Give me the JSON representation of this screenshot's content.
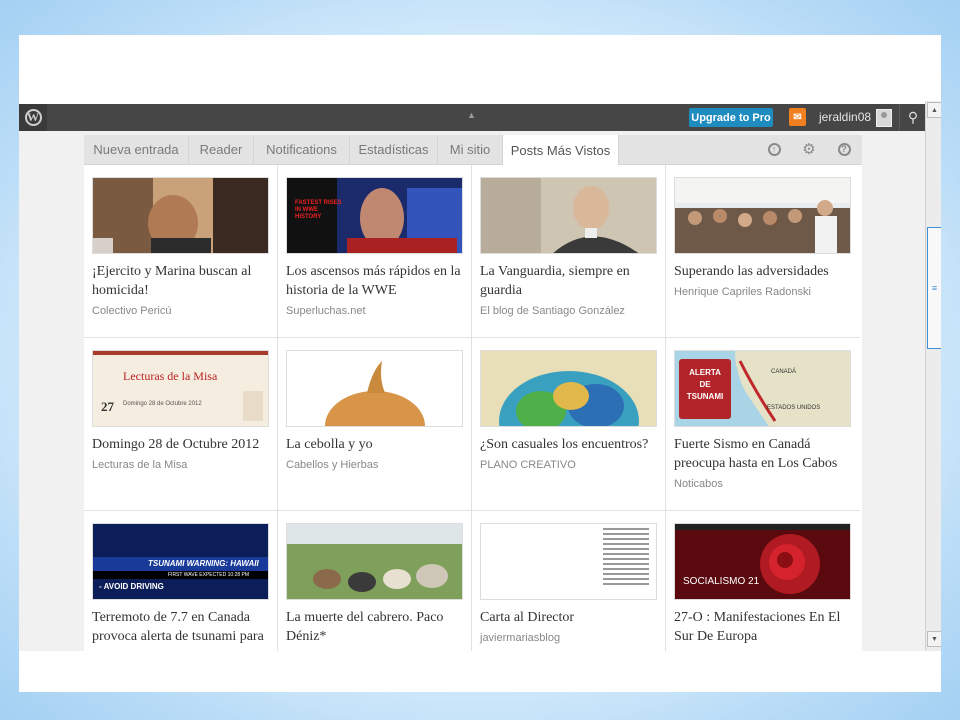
{
  "toolbar": {
    "logo_icon": "wordpress-logo-icon",
    "upgrade_label": "Upgrade to Pro",
    "username": "jeraldin08",
    "notification_icon": "notification-bell-icon",
    "search_icon": "search-icon"
  },
  "tabs": [
    {
      "label": "Nueva entrada"
    },
    {
      "label": "Reader"
    },
    {
      "label": "Notifications"
    },
    {
      "label": "Estadísticas"
    },
    {
      "label": "Mi sitio"
    },
    {
      "label": "Posts Más Vistos"
    }
  ],
  "tab_icons": [
    "upload-icon",
    "gear-icon",
    "help-icon"
  ],
  "posts": [
    {
      "title": "¡Ejercito y Marina buscan al homicida!",
      "source": "Colectivo Pericú"
    },
    {
      "title": "Los ascensos más rápidos en la historia de la WWE",
      "source": "Superluchas.net"
    },
    {
      "title": "La Vanguardia, siempre en guardia",
      "source": "El blog de Santiago González"
    },
    {
      "title": "Superando las adversidades",
      "source": "Henrique Capriles Radonski"
    },
    {
      "title": "Domingo 28 de Octubre 2012",
      "source": "Lecturas de la Misa"
    },
    {
      "title": "La cebolla y yo",
      "source": "Cabellos y Hierbas"
    },
    {
      "title": "¿Son casuales los encuentros?",
      "source": "PLANO CREATIVO"
    },
    {
      "title": "Fuerte Sismo en Canadá preocupa hasta en Los Cabos",
      "source": "Noticabos"
    },
    {
      "title": "Terremoto de 7.7 en Canada provoca alerta de tsunami para",
      "source": ""
    },
    {
      "title": "La muerte del cabrero. Paco Déniz*",
      "source": ""
    },
    {
      "title": "Carta al Director",
      "source": "javiermariasblog"
    },
    {
      "title": "27-O : Manifestaciones En El Sur De Europa",
      "source": ""
    }
  ],
  "thumb_text": {
    "wwe_line1": "FASTEST RISES",
    "wwe_line2": "IN WWE",
    "wwe_line3": "HISTORY",
    "misa_heading": "Lecturas de la Misa",
    "misa_day": "27",
    "misa_sub": "Domingo 28 de Octubre 2012",
    "alert_line1": "ALERTA",
    "alert_line2": "DE",
    "alert_line3": "TSUNAMI",
    "map_label1": "CANADÁ",
    "map_label2": "ESTADOS UNIDOS",
    "tsunami_banner": "TSUNAMI WARNING: HAWAII",
    "tsunami_sub": "FIRST WAVE EXPECTED 10:28 PM",
    "tsunami_note": "- AVOID DRIVING",
    "socialismo": "SOCIALISMO 21"
  }
}
